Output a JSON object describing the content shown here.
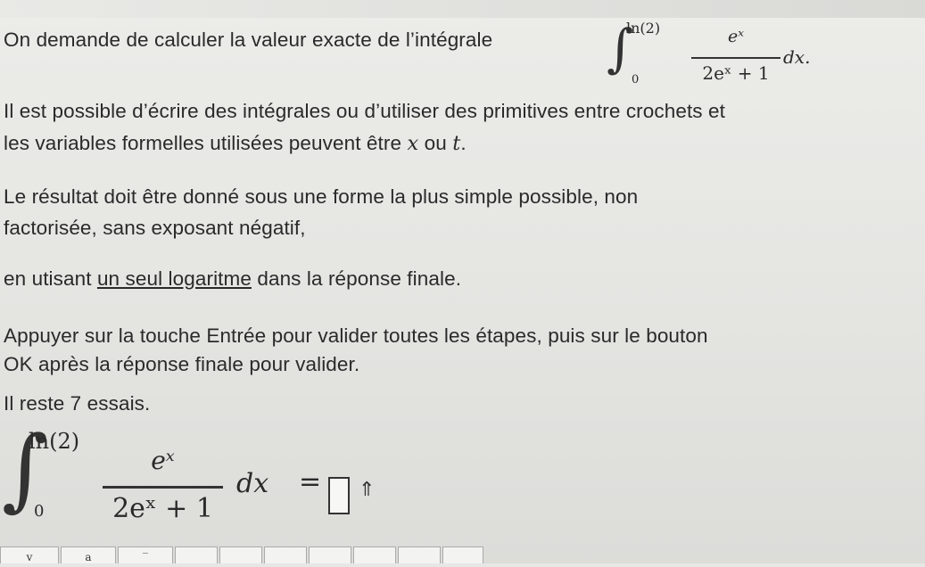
{
  "question": {
    "line1": "On demande de calculer la valeur exacte de l’intégrale",
    "line2": "Il est possible d’écrire des intégrales ou d’utiliser des primitives entre crochets et",
    "line3_pre": "les variables formelles utilisées peuvent être",
    "line3_x": "x",
    "line3_mid": "ou",
    "line3_t": "t",
    "line3_end": ".",
    "line4": "Le résultat doit être donné sous une forme la plus simple possible, non",
    "line5": "factorisée, sans exposant négatif,",
    "line6_pre": "en utisant",
    "line6_u": "un seul logaritme",
    "line6_post": "dans la réponse finale.",
    "line7": "Appuyer sur la touche Entrée pour valider toutes les étapes, puis sur le bouton",
    "line8": "OK après la réponse finale pour valider.",
    "attempts": "Il reste 7 essais."
  },
  "integral": {
    "upper": "ln(2)",
    "lower": "0",
    "numerator": "eˣ",
    "denominator": "2eˣ + 1",
    "differential": "dx",
    "end": "."
  },
  "answer": {
    "equals": "=",
    "caret_icon": "up-arrow-icon"
  },
  "toolbar": {
    "buttons": [
      "v",
      "a",
      "‾",
      "",
      "",
      "",
      "",
      "",
      "",
      ""
    ]
  }
}
